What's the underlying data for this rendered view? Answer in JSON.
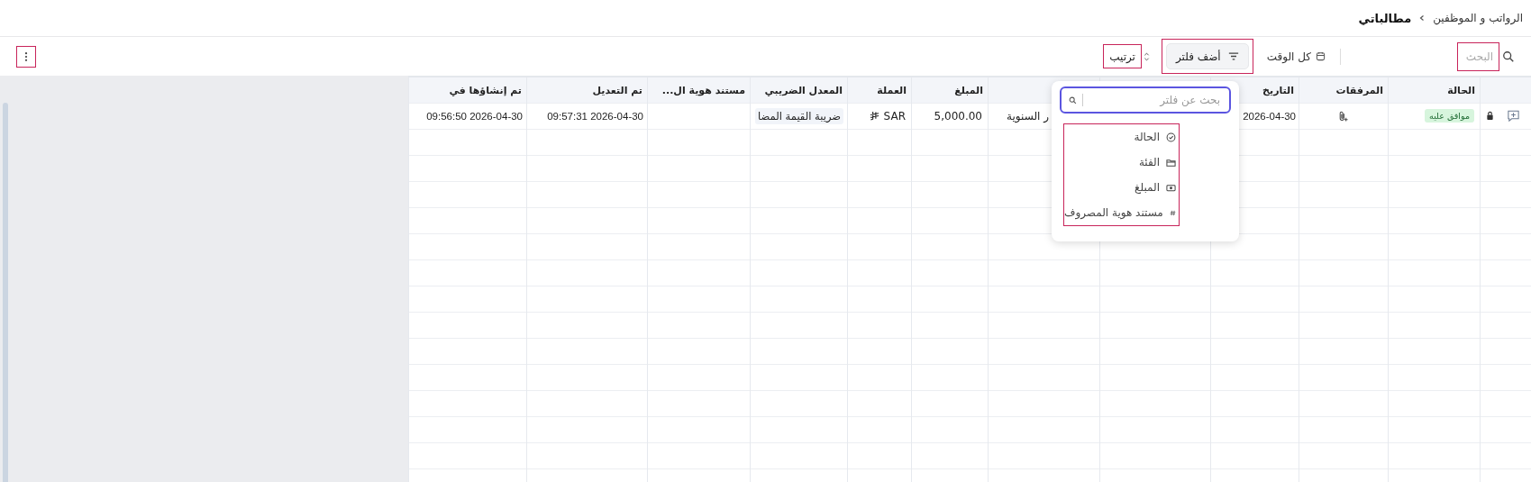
{
  "breadcrumb": [
    {
      "label": "الرواتب و الموظفين",
      "current": false
    },
    {
      "label": "مطالباتي",
      "current": true
    }
  ],
  "toolbar": {
    "search": {
      "placeholder": "البحث"
    },
    "period": "كل الوقت",
    "filter_button": "أضف فلتر",
    "sort_button": "ترتيب"
  },
  "table": {
    "columns": [
      {},
      {
        "label": "الحالة"
      },
      {
        "label": "المرفقات"
      },
      {
        "label": "التاريخ"
      },
      {},
      {},
      {
        "label": "المبلغ"
      },
      {
        "label": "العملة"
      },
      {
        "label": "المعدل الضريبي"
      },
      {
        "label": "مستند هوية ال..."
      },
      {
        "label": "تم التعديل"
      },
      {
        "label": "تم إنشاؤها في"
      }
    ],
    "rows": [
      {
        "status": "موافق عليه",
        "date": "2026-04-30",
        "column_6": "ر السنوية",
        "amount": "5,000.00",
        "currency": "SAR",
        "tax_rate": "ضريبة القيمة المضا",
        "modified": "2026-04-30 09:57:31",
        "created": "2026-04-30 09:56:50"
      }
    ]
  },
  "filter_menu": {
    "placeholder": "بحث عن فلتر",
    "items": [
      {
        "label": "الحالة",
        "kind": "status"
      },
      {
        "label": "الفئة",
        "kind": "category"
      },
      {
        "label": "المبلغ",
        "kind": "amount"
      },
      {
        "label": "مستند هوية المصروف",
        "kind": "id"
      }
    ]
  }
}
